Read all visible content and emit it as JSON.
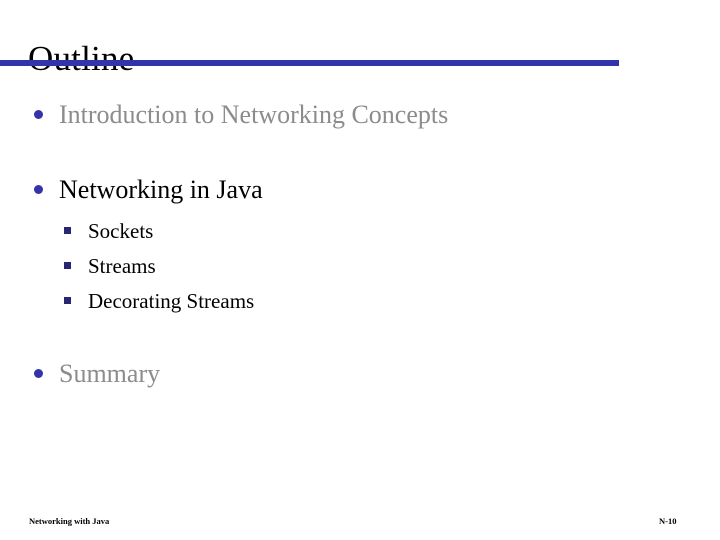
{
  "slide": {
    "title": "Outline",
    "accent_color": "#3333aa",
    "dim_text_color": "#8c8c8c",
    "text_color": "#000000",
    "background_color": "#ffffff"
  },
  "outline": {
    "items": [
      {
        "label": "Introduction to Networking Concepts",
        "style": "dim",
        "marker": "round-bullet"
      },
      {
        "label": "Networking in Java",
        "style": "normal",
        "marker": "round-bullet",
        "children": [
          {
            "label": "Sockets",
            "marker": "square-bullet"
          },
          {
            "label": "Streams",
            "marker": "square-bullet"
          },
          {
            "label": "Decorating Streams",
            "marker": "square-bullet"
          }
        ]
      },
      {
        "label": "Summary",
        "style": "dim",
        "marker": "round-bullet"
      }
    ]
  },
  "footer": {
    "left_text": "Networking with Java",
    "page_number": "N-10"
  }
}
